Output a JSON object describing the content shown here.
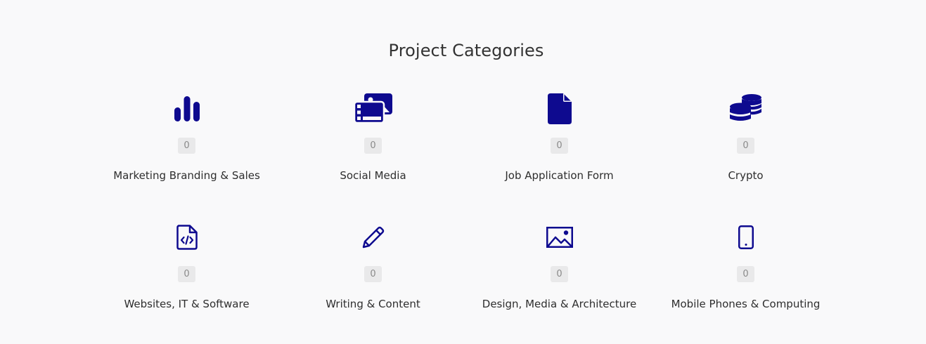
{
  "section": {
    "title": "Project Categories"
  },
  "colors": {
    "icon": "#0e0a8f",
    "background": "#f9f9fa",
    "badge_bg": "#e9e9ea"
  },
  "categories": [
    {
      "label": "Marketing Branding & Sales",
      "count": "0",
      "icon": "bar-chart-icon"
    },
    {
      "label": "Social Media",
      "count": "0",
      "icon": "images-gallery-icon"
    },
    {
      "label": "Job Application Form",
      "count": "0",
      "icon": "document-icon"
    },
    {
      "label": "Crypto",
      "count": "0",
      "icon": "coins-stack-icon"
    },
    {
      "label": "Websites, IT & Software",
      "count": "0",
      "icon": "code-file-icon"
    },
    {
      "label": "Writing & Content",
      "count": "0",
      "icon": "pencil-icon"
    },
    {
      "label": "Design, Media & Architecture",
      "count": "0",
      "icon": "image-icon"
    },
    {
      "label": "Mobile Phones & Computing",
      "count": "0",
      "icon": "mobile-phone-icon"
    }
  ]
}
